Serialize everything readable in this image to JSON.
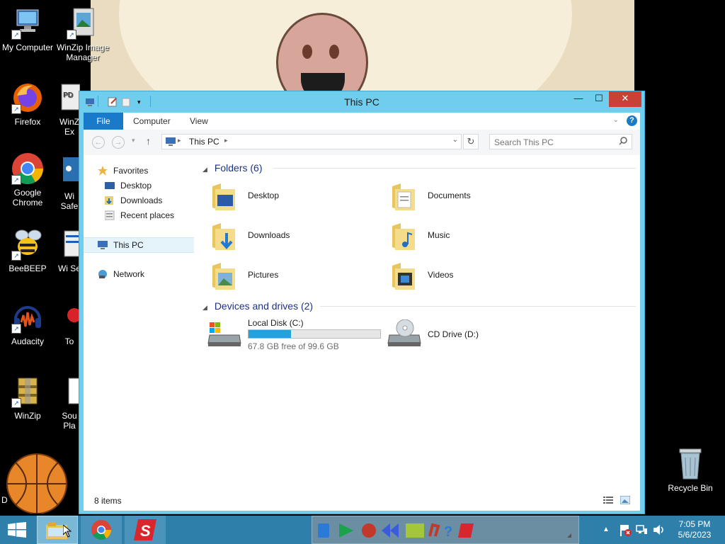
{
  "desktop": {
    "icons": [
      {
        "label": "My Computer",
        "icon": "computer-icon"
      },
      {
        "label": "WinZip Image Manager",
        "icon": "winzip-image-icon"
      },
      {
        "label": "Firefox",
        "icon": "firefox-icon"
      },
      {
        "label": "WinZ Ex",
        "icon": "pdf-icon"
      },
      {
        "label": "Google Chrome",
        "icon": "chrome-icon"
      },
      {
        "label": "Wi Safe",
        "icon": "share-icon"
      },
      {
        "label": "BeeBEEP",
        "icon": "bee-icon"
      },
      {
        "label": "Wi Se",
        "icon": "app-icon"
      },
      {
        "label": "Audacity",
        "icon": "audacity-icon"
      },
      {
        "label": "To",
        "icon": "app-icon"
      },
      {
        "label": "WinZip",
        "icon": "winzip-icon"
      },
      {
        "label": "Sou Pla",
        "icon": "file-icon"
      },
      {
        "label": "D",
        "icon": "basketball-icon"
      },
      {
        "label": "Recycle Bin",
        "icon": "recycle-bin-icon"
      }
    ]
  },
  "window": {
    "title": "This PC",
    "controls": {
      "minimize": "—",
      "maximize": "☐",
      "close": "✕"
    },
    "ribbon_tabs": [
      "File",
      "Computer",
      "View"
    ],
    "address_path": "This PC",
    "search_placeholder": "Search This PC",
    "nav_pane": {
      "favorites_label": "Favorites",
      "favorites": [
        "Desktop",
        "Downloads",
        "Recent places"
      ],
      "this_pc": "This PC",
      "network": "Network"
    },
    "groups": {
      "folders_title": "Folders (6)",
      "folders": [
        "Desktop",
        "Documents",
        "Downloads",
        "Music",
        "Pictures",
        "Videos"
      ],
      "devices_title": "Devices and drives (2)",
      "drives": [
        {
          "name": "Local Disk (C:)",
          "free_text": "67.8 GB free of 99.6 GB",
          "used_fraction": 0.32
        },
        {
          "name": "CD Drive (D:)"
        }
      ]
    },
    "status_text": "8 items"
  },
  "taskbar": {
    "time": "7:05 PM",
    "date": "5/6/2023"
  },
  "colors": {
    "window_frame": "#6fcdee",
    "file_tab": "#1979ca",
    "group_heading": "#1e3287",
    "close_button": "#c94036",
    "taskbar": "#2e80aa",
    "drive_bar": "#26a0da"
  }
}
